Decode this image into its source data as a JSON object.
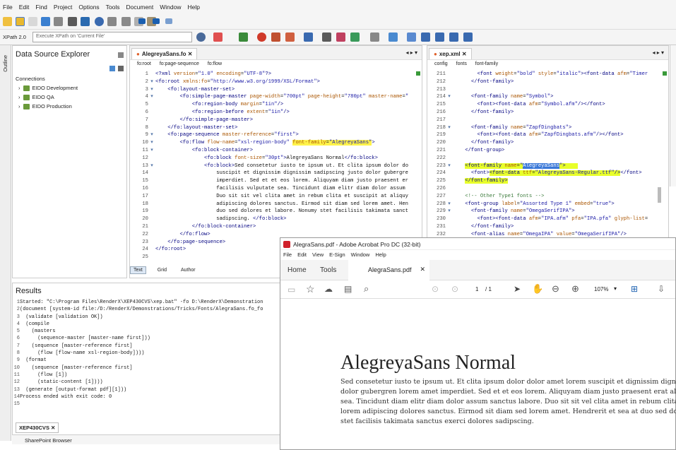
{
  "menu": [
    "File",
    "Edit",
    "Find",
    "Project",
    "Options",
    "Tools",
    "Document",
    "Window",
    "Help"
  ],
  "xpath": {
    "version": "XPath 2.0",
    "placeholder": "Execute XPath on 'Current File'"
  },
  "outline_label": "Outline",
  "dse": {
    "title": "Data Source Explorer",
    "connections_label": "Connections",
    "items": [
      "EIDO Development",
      "EIDO QA",
      "EIDO Production"
    ]
  },
  "editor1": {
    "tab": "AlegreyaSans.fo",
    "crumbs": [
      "fo:root",
      "fo:page-sequence",
      "fo:flow"
    ],
    "bottom_tabs": [
      "Text",
      "Grid",
      "Author"
    ]
  },
  "editor2": {
    "tab": "xep.xml",
    "crumbs": [
      "config",
      "fonts",
      "font-family"
    ]
  },
  "results": {
    "title": "Results",
    "lines": [
      "Started: \"C:\\Program Files\\RenderX\\XEP430CVS\\xep.bat\" -fo D:\\RenderX\\Demonstration",
      "(document [system-id file:/D:/RenderX/Demonstrations/Tricks/Fonts/AlegraSans.fo_fo",
      "  (validate [validation OK])",
      "  (compile",
      "    (masters",
      "      (sequence-master [master-name first]))",
      "    (sequence [master-reference first]",
      "      (flow [flow-name xsl-region-body])))",
      "  (format",
      "    (sequence [master-reference first]",
      "      (flow [1])",
      "      (static-content [1])))",
      "  (generate [output-format pdf][1]))",
      "Process ended with exit code: 0",
      ""
    ],
    "tab": "XEP430CVS",
    "sharepoint": "SharePoint Browser"
  },
  "acrobat": {
    "title": "AlegraSans.pdf - Adobe Acrobat Pro DC (32-bit)",
    "menu": [
      "File",
      "Edit",
      "View",
      "E-Sign",
      "Window",
      "Help"
    ],
    "nav": [
      "Home",
      "Tools"
    ],
    "doc_tab": "AlegraSans.pdf",
    "page_current": "1",
    "page_total": "/ 1",
    "zoom": "107%",
    "heading": "AlegreyaSans Normal",
    "paragraph": [
      "Sed consetetur iusto te ipsum ut. Et clita ipsum dolor dolor amet lorem suscipit et dignissim dignissi",
      "dolor gubergren lorem amet imperdiet. Sed et et eos lorem. Aliquyam diam justo praesent erat aliquy",
      "sea. Tincidunt diam elitr diam dolor assum sanctus labore. Duo sit sit vel clita amet in rebum clita et",
      "lorem adipiscing dolores sanctus. Eirmod sit diam sed lorem amet. Hendrerit et sea at duo sed dolore",
      "stet facilisis takimata sanctus exerci dolores sadipscing."
    ]
  },
  "colors": {
    "highlight": "#fff34a",
    "selection": "#3a78d8",
    "tag": "#000080",
    "attr": "#aa5500"
  }
}
